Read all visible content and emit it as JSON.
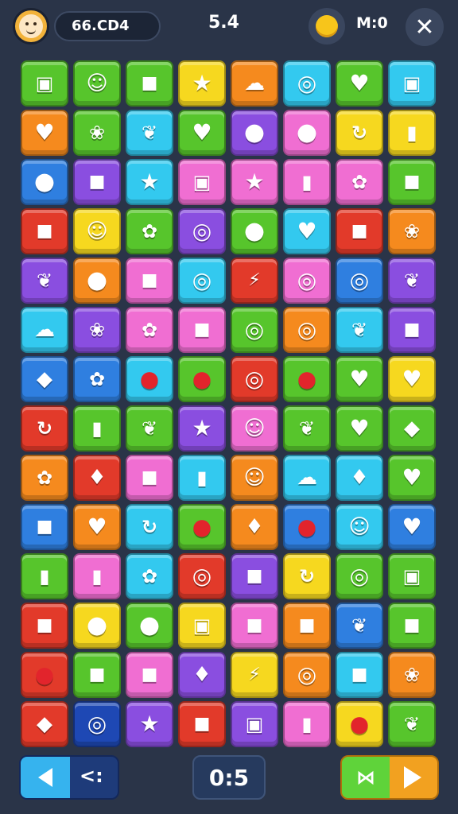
{
  "header": {
    "coins": "66.CD4",
    "score": "5.4",
    "moves_label": "M:0",
    "close_glyph": "✕"
  },
  "footer": {
    "undo_glyph": "<:",
    "timer": "0:5"
  },
  "colors": {
    "background": "#2a3448",
    "tile_palette": {
      "green": "#57c52c",
      "blue": "#2f7fe0",
      "cyan": "#33c9ef",
      "yellow": "#f6d81f",
      "orange": "#f58a1e",
      "red": "#e23a2a",
      "purple": "#8a4ee0",
      "pink": "#f06ed2",
      "navy": "#1e48b4"
    }
  },
  "board": {
    "columns": 8,
    "rows": 14,
    "tiles": [
      [
        "green:cube",
        "green:face",
        "green:box",
        "yellow:star",
        "orange:cloud",
        "cyan:ring",
        "green:heart",
        "cyan:cube"
      ],
      [
        "orange:heart",
        "green:blob",
        "cyan:leaf",
        "green:heart",
        "purple:circle",
        "pink:circle",
        "yellow:spiral",
        "yellow:jar"
      ],
      [
        "blue:circle",
        "purple:box",
        "cyan:star",
        "pink:cube",
        "pink:star",
        "pink:jar",
        "pink:flower",
        "green:box"
      ],
      [
        "red:box",
        "yellow:face",
        "green:flower",
        "purple:ring",
        "green:circle",
        "cyan:heart",
        "red:box",
        "orange:blob"
      ],
      [
        "purple:leaf",
        "orange:circle",
        "pink:box",
        "cyan:ring",
        "red:bolt",
        "pink:ring",
        "blue:ring",
        "purple:leaf"
      ],
      [
        "cyan:cloud",
        "purple:blob",
        "pink:flower",
        "pink:box",
        "green:ring",
        "orange:ring",
        "cyan:leaf",
        "purple:box"
      ],
      [
        "blue:diamond",
        "blue:flower",
        "cyan:apple",
        "green:apple",
        "red:ring",
        "green:apple",
        "green:heart",
        "yellow:heart"
      ],
      [
        "red:spiral",
        "green:jar",
        "green:leaf",
        "purple:star",
        "pink:face",
        "green:leaf",
        "green:heart",
        "green:diamond"
      ],
      [
        "orange:flower",
        "red:drop",
        "pink:box",
        "cyan:jar",
        "orange:face",
        "cyan:cloud",
        "cyan:drop",
        "green:heart"
      ],
      [
        "blue:box",
        "orange:heart",
        "cyan:spiral",
        "green:apple",
        "orange:drop",
        "blue:apple",
        "cyan:face",
        "blue:heart"
      ],
      [
        "green:jar",
        "pink:jar",
        "cyan:flower",
        "red:ring",
        "purple:box",
        "yellow:spiral",
        "green:ring",
        "green:cube"
      ],
      [
        "red:box",
        "yellow:circle",
        "green:circle",
        "yellow:cube",
        "pink:box",
        "orange:box",
        "blue:leaf",
        "green:box"
      ],
      [
        "red:apple",
        "green:box",
        "pink:box",
        "purple:drop",
        "yellow:bolt",
        "orange:ring",
        "cyan:box",
        "orange:blob"
      ],
      [
        "red:diamond",
        "navy:ring",
        "purple:star",
        "red:box",
        "purple:cube",
        "pink:jar",
        "yellow:apple",
        "green:leaf"
      ]
    ]
  }
}
